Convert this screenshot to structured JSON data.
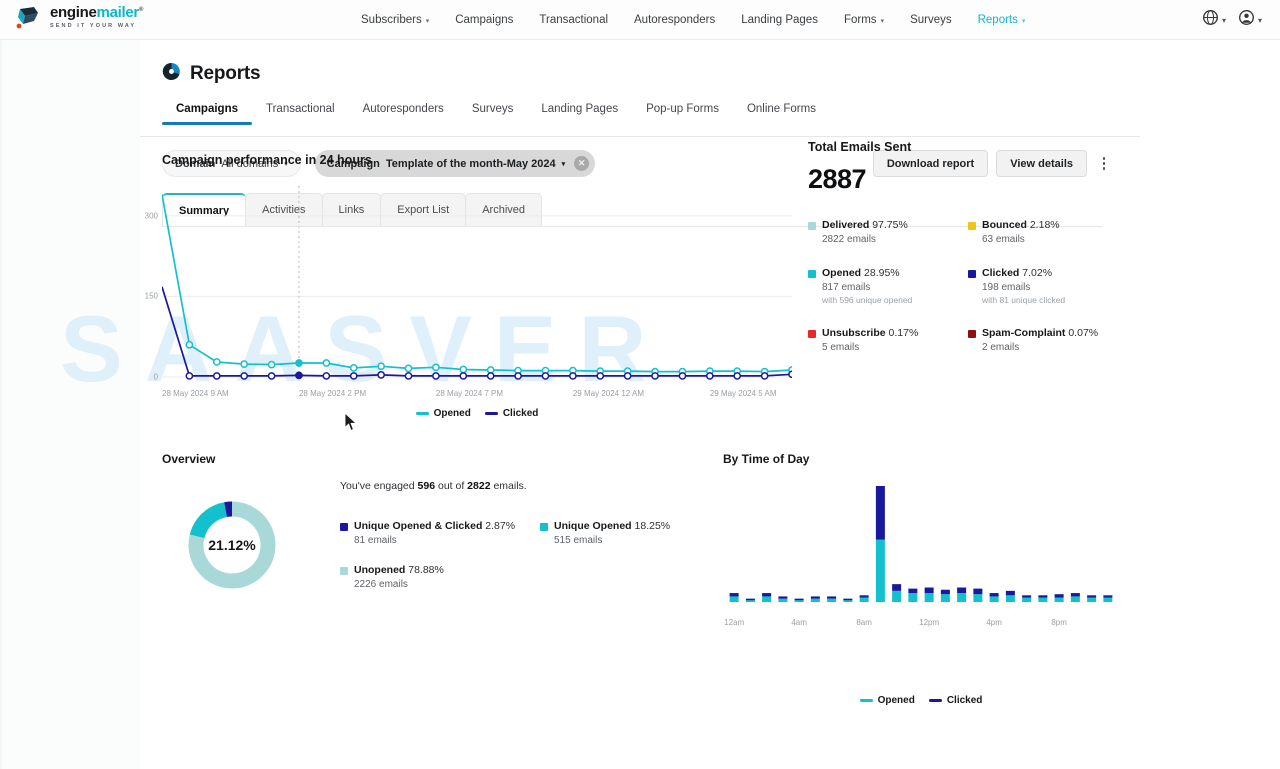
{
  "brand": {
    "name_dark": "engine",
    "name_teal": "mailer",
    "sup": "®",
    "tagline": "SEND IT YOUR WAY"
  },
  "topnav": {
    "items": [
      {
        "label": "Subscribers",
        "caret": true,
        "active": false
      },
      {
        "label": "Campaigns",
        "caret": false,
        "active": false
      },
      {
        "label": "Transactional",
        "caret": false,
        "active": false
      },
      {
        "label": "Autoresponders",
        "caret": false,
        "active": false
      },
      {
        "label": "Landing Pages",
        "caret": false,
        "active": false
      },
      {
        "label": "Forms",
        "caret": true,
        "active": false
      },
      {
        "label": "Surveys",
        "caret": false,
        "active": false
      },
      {
        "label": "Reports",
        "caret": true,
        "active": true
      }
    ],
    "right": [
      {
        "icon": "globe-icon",
        "caret": "▾"
      },
      {
        "icon": "user-avatar-icon",
        "caret": "▾"
      }
    ]
  },
  "page": {
    "title": "Reports",
    "title_icon": "pie-chart-icon",
    "watermark": "SAASVER"
  },
  "main_tabs": [
    {
      "label": "Campaigns",
      "active": true
    },
    {
      "label": "Transactional",
      "active": false
    },
    {
      "label": "Autoresponders",
      "active": false
    },
    {
      "label": "Surveys",
      "active": false
    },
    {
      "label": "Landing Pages",
      "active": false
    },
    {
      "label": "Pop-up Forms",
      "active": false
    },
    {
      "label": "Online Forms",
      "active": false
    }
  ],
  "filters": {
    "domain": {
      "label": "Domain",
      "value": "All domains",
      "caret": "▾"
    },
    "campaign": {
      "label": "Campaign",
      "value": "Template of the month-May 2024",
      "caret": "▾",
      "clear": "✕"
    }
  },
  "actions": {
    "download": "Download report",
    "view_details": "View details",
    "more_icon": "kebab-menu-icon"
  },
  "sub_tabs": [
    {
      "label": "Summary",
      "active": true
    },
    {
      "label": "Activities",
      "active": false
    },
    {
      "label": "Links",
      "active": false
    },
    {
      "label": "Export List",
      "active": false
    },
    {
      "label": "Archived",
      "active": false
    }
  ],
  "totals": {
    "heading": "Total Emails Sent",
    "value": "2887",
    "stats": [
      {
        "name": "Delivered",
        "pct": "97.75%",
        "emails": "2822 emails",
        "note": "",
        "color": "#a8d8d8"
      },
      {
        "name": "Bounced",
        "pct": "2.18%",
        "emails": "63 emails",
        "note": "",
        "color": "#f0c419"
      },
      {
        "name": "Opened",
        "pct": "28.95%",
        "emails": "817 emails",
        "note": "with 596 unique opened",
        "color": "#12c1cd"
      },
      {
        "name": "Clicked",
        "pct": "7.02%",
        "emails": "198 emails",
        "note": "with 81 unique clicked",
        "color": "#1a189c"
      },
      {
        "name": "Unsubscribe",
        "pct": "0.17%",
        "emails": "5 emails",
        "note": "",
        "color": "#e8282b"
      },
      {
        "name": "Spam-Complaint",
        "pct": "0.07%",
        "emails": "2 emails",
        "note": "",
        "color": "#8c1010"
      }
    ]
  },
  "overview": {
    "title": "Overview",
    "center_pct": "21.12%",
    "headline_pre": "You've engaged ",
    "headline_engaged": "596",
    "headline_mid": " out of ",
    "headline_total": "2822",
    "headline_post": " emails.",
    "stats": [
      {
        "name": "Unique Opened & Clicked",
        "pct": "2.87%",
        "emails": "81 emails",
        "color": "#1a189c"
      },
      {
        "name": "Unique Opened",
        "pct": "18.25%",
        "emails": "515 emails",
        "color": "#12c1cd"
      },
      {
        "name": "Unopened",
        "pct": "78.88%",
        "emails": "2226 emails",
        "color": "#a8d8d8"
      }
    ]
  },
  "by_time_of_day": {
    "title": "By Time of Day"
  },
  "legend": {
    "opened": "Opened",
    "clicked": "Clicked",
    "opened_color": "#12c1cd",
    "clicked_color": "#1a189c"
  },
  "chart_data": [
    {
      "type": "line",
      "title": "Campaign performance in 24 hours",
      "xlabel": "",
      "ylabel": "",
      "ylim": [
        0,
        350
      ],
      "yticks": [
        "0",
        "150",
        "300"
      ],
      "grid": true,
      "legend_position": "bottom",
      "x_tick_labels": [
        "28 May 2024 9 AM",
        "28 May 2024 2 PM",
        "28 May 2024 7 PM",
        "29 May 2024 12 AM",
        "29 May 2024 5 AM"
      ],
      "x_tick_positions": [
        0,
        5,
        10,
        15,
        20
      ],
      "series": [
        {
          "name": "Opened",
          "color": "#12c1cd",
          "values": [
            340,
            60,
            28,
            24,
            23,
            26,
            26,
            17,
            20,
            16,
            18,
            14,
            13,
            12,
            12,
            12,
            11,
            11,
            10,
            10,
            11,
            11,
            10,
            13
          ]
        },
        {
          "name": "Clicked",
          "color": "#1a189c",
          "values": [
            168,
            2,
            2,
            2,
            2,
            3,
            2,
            2,
            4,
            2,
            2,
            2,
            2,
            2,
            2,
            2,
            2,
            2,
            2,
            2,
            2,
            2,
            2,
            5
          ]
        }
      ],
      "annotation": {
        "type": "vertical-dashed-line",
        "at_index": 5,
        "label": "hover"
      }
    },
    {
      "type": "bar",
      "stacked": true,
      "title": "By Time of Day",
      "legend_position": "bottom",
      "categories": [
        "12am",
        "1am",
        "2am",
        "3am",
        "4am",
        "5am",
        "6am",
        "7am",
        "8am",
        "9am",
        "10am",
        "11am",
        "12pm",
        "1pm",
        "2pm",
        "3pm",
        "4pm",
        "5pm",
        "6pm",
        "7pm",
        "8pm",
        "9pm",
        "10pm",
        "11pm"
      ],
      "x_tick_labels": [
        "12am",
        "4am",
        "8am",
        "12pm",
        "4pm",
        "8pm"
      ],
      "series": [
        {
          "name": "Opened",
          "color": "#12c1cd",
          "values": [
            5,
            2,
            5,
            3,
            2,
            3,
            3,
            2,
            4,
            56,
            10,
            8,
            8,
            7,
            8,
            7,
            5,
            6,
            4,
            4,
            4,
            5,
            4,
            4
          ]
        },
        {
          "name": "Clicked",
          "color": "#1a189c",
          "values": [
            3,
            1,
            3,
            2,
            1,
            2,
            2,
            1,
            2,
            48,
            6,
            4,
            5,
            4,
            5,
            5,
            3,
            4,
            2,
            2,
            3,
            3,
            2,
            2
          ]
        }
      ]
    },
    {
      "type": "pie",
      "title": "Overview",
      "labels": [
        "Unique Opened & Clicked",
        "Unique Opened",
        "Unopened"
      ],
      "values": [
        2.87,
        18.25,
        78.88
      ],
      "colors": [
        "#1a189c",
        "#12c1cd",
        "#a8d8d8"
      ],
      "center_label": "21.12%",
      "donut": true
    }
  ]
}
